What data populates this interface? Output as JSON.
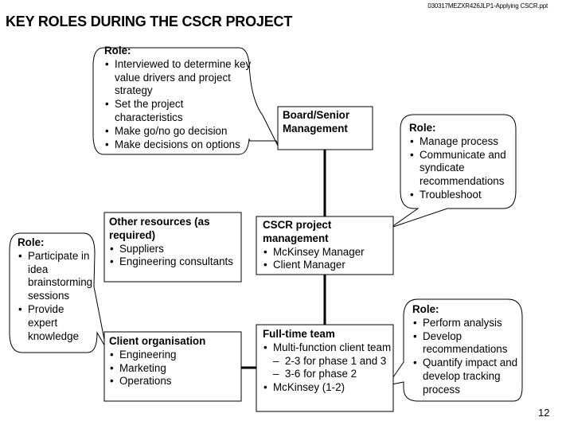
{
  "header": {
    "doc_id": "030317MEZXR426JLP1-Applying CSCR.ppt",
    "title": "KEY ROLES DURING THE CSCR PROJECT",
    "page_number": "12"
  },
  "boxes": {
    "board": {
      "heading": "Board/Senior Management"
    },
    "cscr_pm": {
      "heading": "CSCR project management",
      "items": [
        "McKinsey Manager",
        "Client Manager"
      ]
    },
    "full_time": {
      "heading": "Full-time team",
      "items": [
        "Multi-function client team",
        "2-3 for phase 1 and 3",
        "3-6 for phase 2",
        "McKinsey (1-2)"
      ]
    },
    "other_res": {
      "heading": "Other resources (as required)",
      "items": [
        "Suppliers",
        "Engineering consultants"
      ]
    },
    "client_org": {
      "heading": "Client organisation",
      "items": [
        "Engineering",
        "Marketing",
        "Operations"
      ]
    }
  },
  "callouts": {
    "board_role": {
      "heading": "Role:",
      "items": [
        "Interviewed to determine key value drivers and project strategy",
        "Set the project characteristics",
        "Make go/no go decision",
        "Make decisions on options"
      ]
    },
    "pm_role": {
      "heading": "Role:",
      "items": [
        "Manage process",
        "Communicate and syndicate recommendations",
        "Troubleshoot"
      ]
    },
    "client_role": {
      "heading": "Role:",
      "items": [
        "Participate in idea brainstorming sessions",
        "Provide expert knowledge"
      ]
    },
    "team_role": {
      "heading": "Role:",
      "items": [
        "Perform analysis",
        "Develop recommendations",
        "Quantify impact and develop tracking process"
      ]
    }
  }
}
